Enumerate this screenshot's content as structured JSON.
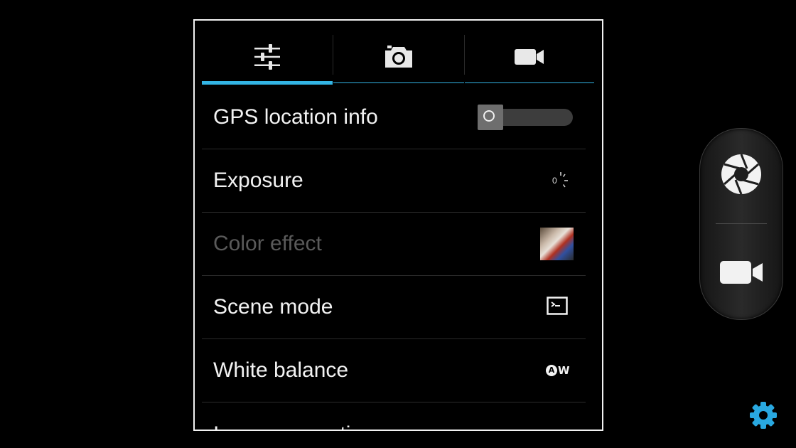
{
  "tabs": [
    {
      "icon": "sliders-icon",
      "active": true
    },
    {
      "icon": "camera-icon",
      "active": false
    },
    {
      "icon": "video-camera-icon",
      "active": false
    }
  ],
  "settings": {
    "gps": {
      "label": "GPS location info",
      "enabled": false
    },
    "exposure": {
      "label": "Exposure",
      "value": "0"
    },
    "color_effect": {
      "label": "Color effect",
      "disabled": true
    },
    "scene_mode": {
      "label": "Scene mode"
    },
    "white_balance": {
      "label": "White balance",
      "value_a": "A",
      "value_w": "W"
    },
    "partial": {
      "label": "Image properties"
    }
  },
  "controls": {
    "shutter_icon": "shutter-icon",
    "video_icon": "video-camera-icon",
    "settings_icon": "gear-icon"
  },
  "colors": {
    "accent": "#33b5e5",
    "text": "#f2f2f2",
    "disabled_text": "#5a5a5a"
  }
}
